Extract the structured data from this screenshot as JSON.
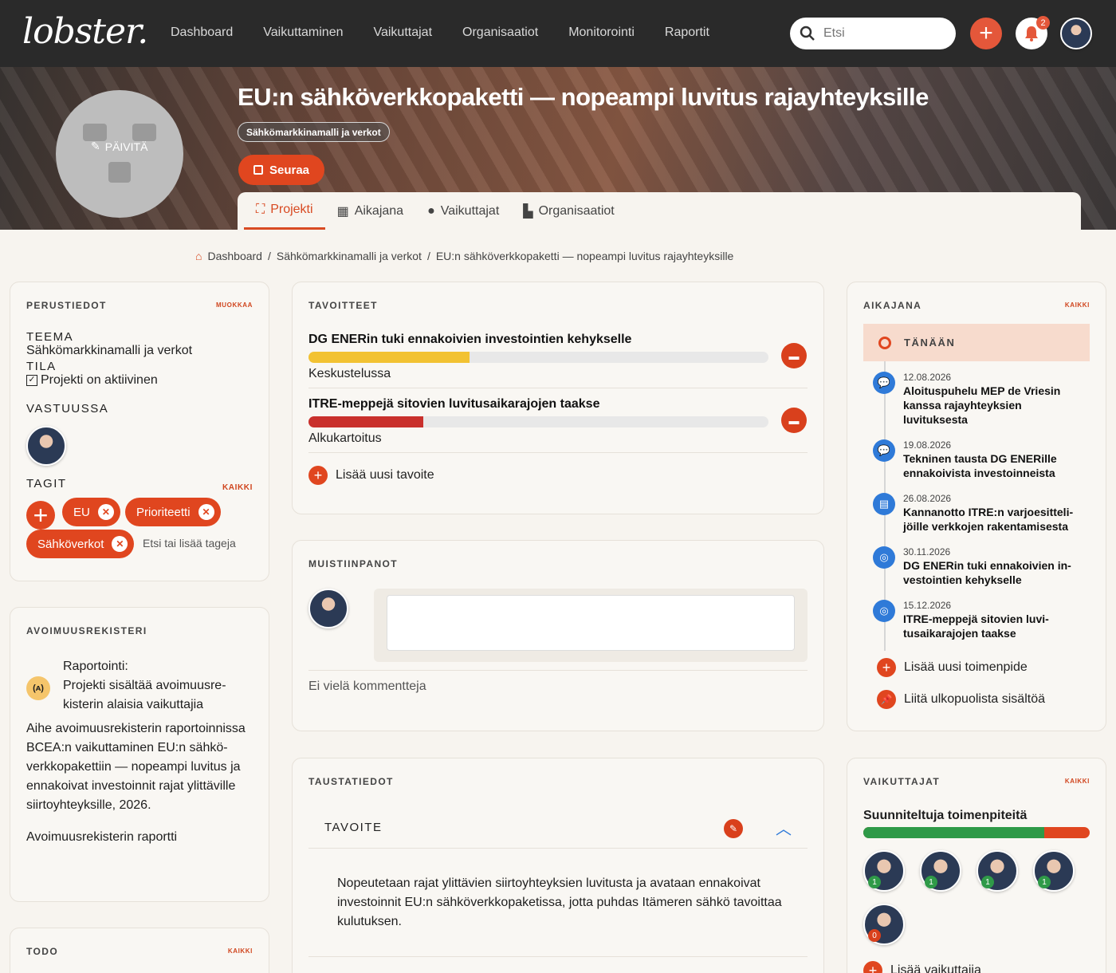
{
  "brand": {
    "logo_text": "lobster."
  },
  "nav": {
    "items": [
      "Dashboard",
      "Vaikuttaminen",
      "Vaikuttajat",
      "Organisaatiot",
      "Monitorointi",
      "Raportit"
    ]
  },
  "search": {
    "placeholder": "Etsi"
  },
  "notifications": {
    "count": "2"
  },
  "hero": {
    "update_label": "PÄIVITÄ",
    "title": "EU:n sähköverkkopaketti — nopeampi luvitus rajayhteyksille",
    "chip": "Sähkömarkkinamalli ja verkot",
    "follow_label": "Seuraa"
  },
  "tabs": [
    {
      "label": "Projekti",
      "icon": "sitemap-icon"
    },
    {
      "label": "Aikajana",
      "icon": "calendar-icon"
    },
    {
      "label": "Vaikuttajat",
      "icon": "user-icon"
    },
    {
      "label": "Organisaatiot",
      "icon": "industry-icon"
    }
  ],
  "breadcrumb": {
    "items": [
      "Dashboard",
      "Sähkömarkkinamalli ja verkot",
      "EU:n sähköverkkopaketti — nopeampi luvitus rajayhteyksille"
    ]
  },
  "basics": {
    "heading": "PERUSTIEDOT",
    "edit": "MUOKKAA",
    "theme_label": "TEEMA",
    "theme_value": "Sähkömarkkinamalli ja verkot",
    "status_label": "TILA",
    "status_value": "Projekti on aktiivinen",
    "owner_label": "VASTUUSSA",
    "tags_label": "TAGIT",
    "tags_all": "KAIKKI",
    "tags": [
      "EU",
      "Prioriteetti",
      "Sähköverkot"
    ],
    "tag_input_placeholder": "Etsi tai lisää tageja"
  },
  "register": {
    "heading": "AVOIMUUSREKISTERI",
    "report_title": "Raportointi:",
    "report_text": "Projekti sisältää avoimuusre­kisterin alaisia vaikuttajia",
    "topic_title": "Aihe avoimuusrekisterin raportoin­nissa",
    "topic_text": "BCEA:n vaikuttaminen EU:n sähkö­verkkopakettiin — nopeampi luvitus ja ennakoivat investoinnit rajat ylittä­ville siirtoyhteyksille, 2026.",
    "report_link": "Avoimuusrekisterin raportti"
  },
  "todo": {
    "heading": "TODO",
    "all": "KAIKKI"
  },
  "goals": {
    "heading": "TAVOITTEET",
    "items": [
      {
        "title": "DG ENERin tuki ennakoivien investointien kehykselle",
        "status": "Keskustelussa",
        "progress": 0.35,
        "color": "#f2c232"
      },
      {
        "title": "ITRE-meppejä sitovien luvitusaikarajojen taakse",
        "status": "Alkukartoitus",
        "progress": 0.25,
        "color": "#c9302c"
      }
    ],
    "add_label": "Lisää uusi tavoite"
  },
  "notes": {
    "heading": "MUISTIINPANOT",
    "empty": "Ei vielä kommentteja"
  },
  "background": {
    "heading": "TAUSTATIEDOT",
    "section": "TAVOITE",
    "text": "Nopeutetaan rajat ylittävien siirtoyhteyksien luvitusta ja avataan ennakoi­vat investoinnit EU:n sähköverkkopaketissa, jotta puhdas Itämeren sähkö tavoittaa kulutuksen."
  },
  "timeline": {
    "heading": "AIKAJANA",
    "all": "KAIKKI",
    "today": "TÄNÄÄN",
    "items": [
      {
        "date": "12.08.2026",
        "title": "Aloituspuhelu MEP de Vriesin kanssa rajayhteyksien luvituksesta",
        "icon": "chat-icon"
      },
      {
        "date": "19.08.2026",
        "title": "Tekninen tausta DG ENERille ennakoivista investoinneista",
        "icon": "chat-icon"
      },
      {
        "date": "26.08.2026",
        "title": "Kannanotto ITRE:n varjoesitteli­jöille verkkojen rakentamisesta",
        "icon": "document-icon"
      },
      {
        "date": "30.11.2026",
        "title": "DG ENERin tuki ennakoivien in­vestointien kehykselle",
        "icon": "target-icon"
      },
      {
        "date": "15.12.2026",
        "title": "ITRE-meppejä sitovien luvi­tusaikarajojen taakse",
        "icon": "target-icon"
      }
    ],
    "add_action": "Lisää uusi toimenpide",
    "attach": "Liitä ulkopuolista sisältöä"
  },
  "influencers": {
    "heading": "VAIKUTTAJAT",
    "all": "KAIKKI",
    "planned": "Suunniteltuja toimenpiteitä",
    "planned_done": 0.8,
    "people": [
      {
        "count": "1"
      },
      {
        "count": "1"
      },
      {
        "count": "1"
      },
      {
        "count": "1"
      },
      {
        "count": "0"
      }
    ],
    "add_label": "Lisää vaikuttajia"
  }
}
